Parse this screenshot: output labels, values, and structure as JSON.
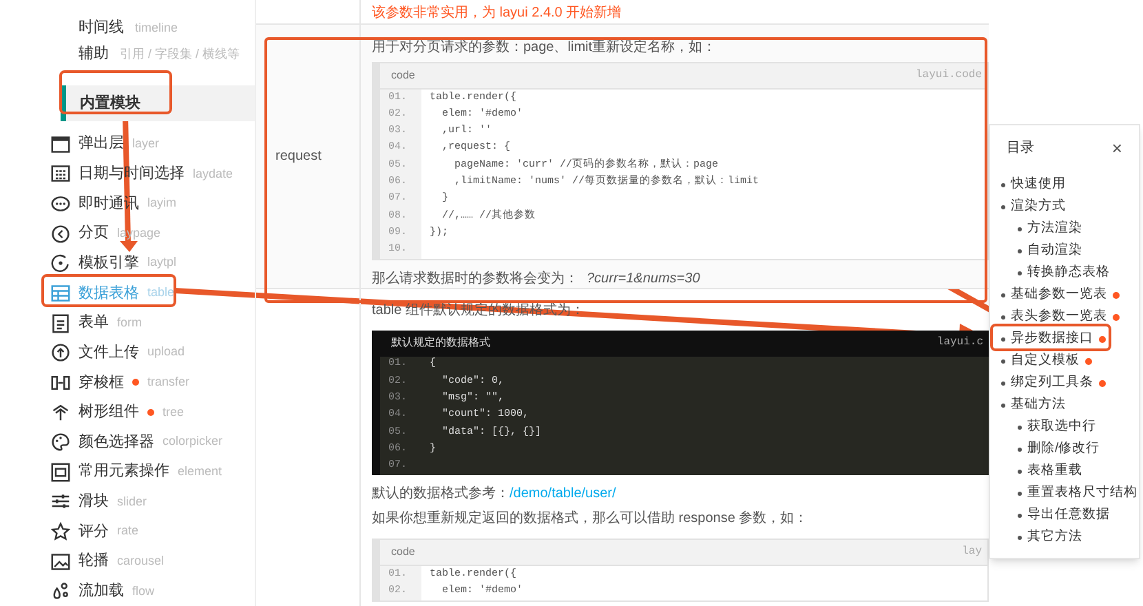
{
  "sidebar": {
    "items": [
      {
        "label": "时间线",
        "sub": "timeline"
      },
      {
        "label": "辅助",
        "sub": "引用 / 字段集 / 横线等"
      }
    ],
    "section": {
      "label": "内置模块"
    },
    "modules": [
      {
        "label": "弹出层",
        "sub": "layer",
        "selected": false,
        "dot": false
      },
      {
        "label": "日期与时间选择",
        "sub": "laydate",
        "selected": false,
        "dot": false
      },
      {
        "label": "即时通讯",
        "sub": "layim",
        "selected": false,
        "dot": false
      },
      {
        "label": "分页",
        "sub": "laypage",
        "selected": false,
        "dot": false
      },
      {
        "label": "模板引擎",
        "sub": "laytpl",
        "selected": false,
        "dot": false
      },
      {
        "label": "数据表格",
        "sub": "table",
        "selected": true,
        "dot": false
      },
      {
        "label": "表单",
        "sub": "form",
        "selected": false,
        "dot": false
      },
      {
        "label": "文件上传",
        "sub": "upload",
        "selected": false,
        "dot": false
      },
      {
        "label": "穿梭框",
        "sub": "transfer",
        "selected": false,
        "dot": true
      },
      {
        "label": "树形组件",
        "sub": "tree",
        "selected": false,
        "dot": true
      },
      {
        "label": "颜色选择器",
        "sub": "colorpicker",
        "selected": false,
        "dot": false
      },
      {
        "label": "常用元素操作",
        "sub": "element",
        "selected": false,
        "dot": false
      },
      {
        "label": "滑块",
        "sub": "slider",
        "selected": false,
        "dot": false
      },
      {
        "label": "评分",
        "sub": "rate",
        "selected": false,
        "dot": false
      },
      {
        "label": "轮播",
        "sub": "carousel",
        "selected": false,
        "dot": false
      },
      {
        "label": "流加载",
        "sub": "flow",
        "selected": false,
        "dot": false
      }
    ]
  },
  "notice": "该参数非常实用，为 layui 2.4.0 开始新增",
  "param": {
    "name": "request",
    "blocks": [
      {
        "kind": "text",
        "text": "用于对分页请求的参数：page、limit重新设定名称，如："
      },
      {
        "kind": "code",
        "title": "code",
        "brand": "layui.code",
        "lines": [
          {
            "number": "01.",
            "code": "table.render({"
          },
          {
            "number": "02.",
            "code": "  elem: '#demo'"
          },
          {
            "number": "03.",
            "code": "  ,url: ''"
          },
          {
            "number": "04.",
            "code": "  ,request: {"
          },
          {
            "number": "05.",
            "code": "    pageName: 'curr' //页码的参数名称，默认：page"
          },
          {
            "number": "06.",
            "code": "    ,limitName: 'nums' //每页数据量的参数名，默认：limit"
          },
          {
            "number": "07.",
            "code": "  }"
          },
          {
            "number": "08.",
            "code": "  //,…… //其他参数"
          },
          {
            "number": "09.",
            "code": "});"
          },
          {
            "number": "10."
          }
        ]
      },
      {
        "kind": "text",
        "text": "那么请求数据时的参数将会变为：",
        "tail": "?curr=1&nums=30"
      }
    ]
  },
  "more": [
    {
      "kind": "text",
      "text": "table 组件默认规定的数据格式为："
    },
    {
      "kind": "darkcode",
      "title": "默认规定的数据格式",
      "brand": "layui.c",
      "lines": [
        {
          "number": "01.",
          "code": "{"
        },
        {
          "number": "02.",
          "code": "  \"code\": 0,"
        },
        {
          "number": "03.",
          "code": "  \"msg\": \"\","
        },
        {
          "number": "04.",
          "code": "  \"count\": 1000,"
        },
        {
          "number": "05.",
          "code": "  \"data\": [{}, {}]"
        },
        {
          "number": "06.",
          "code": "}"
        },
        {
          "number": "07."
        }
      ]
    },
    {
      "kind": "link",
      "text": "默认的数据格式参考：",
      "link": "/demo/table/user/"
    },
    {
      "kind": "text",
      "text": "如果你想重新规定返回的数据格式，那么可以借助 response 参数，如："
    },
    {
      "kind": "code",
      "title": "code",
      "brand": "lay",
      "lines": [
        {
          "number": "01.",
          "code": "table.render({"
        },
        {
          "number": "02.",
          "code": "  elem: '#demo'"
        }
      ]
    }
  ],
  "toc": {
    "title": "目录",
    "close": "×",
    "items": [
      {
        "label": "快速使用",
        "dot": false
      },
      {
        "label": "渲染方式",
        "dot": false,
        "children": [
          {
            "label": "方法渲染",
            "dot": false
          },
          {
            "label": "自动渲染",
            "dot": false
          },
          {
            "label": "转换静态表格",
            "dot": false
          }
        ]
      },
      {
        "label": "基础参数一览表",
        "dot": true
      },
      {
        "label": "表头参数一览表",
        "dot": true
      },
      {
        "label": "异步数据接口",
        "dot": true
      },
      {
        "label": "自定义模板",
        "dot": true
      },
      {
        "label": "绑定列工具条",
        "dot": true
      },
      {
        "label": "基础方法",
        "dot": false,
        "children": [
          {
            "label": "获取选中行",
            "dot": false
          },
          {
            "label": "删除/修改行",
            "dot": false
          },
          {
            "label": "表格重载",
            "dot": false
          },
          {
            "label": "重置表格尺寸结构",
            "dot": false
          },
          {
            "label": "导出任意数据",
            "dot": false
          },
          {
            "label": "其它方法",
            "dot": false
          }
        ]
      }
    ]
  }
}
